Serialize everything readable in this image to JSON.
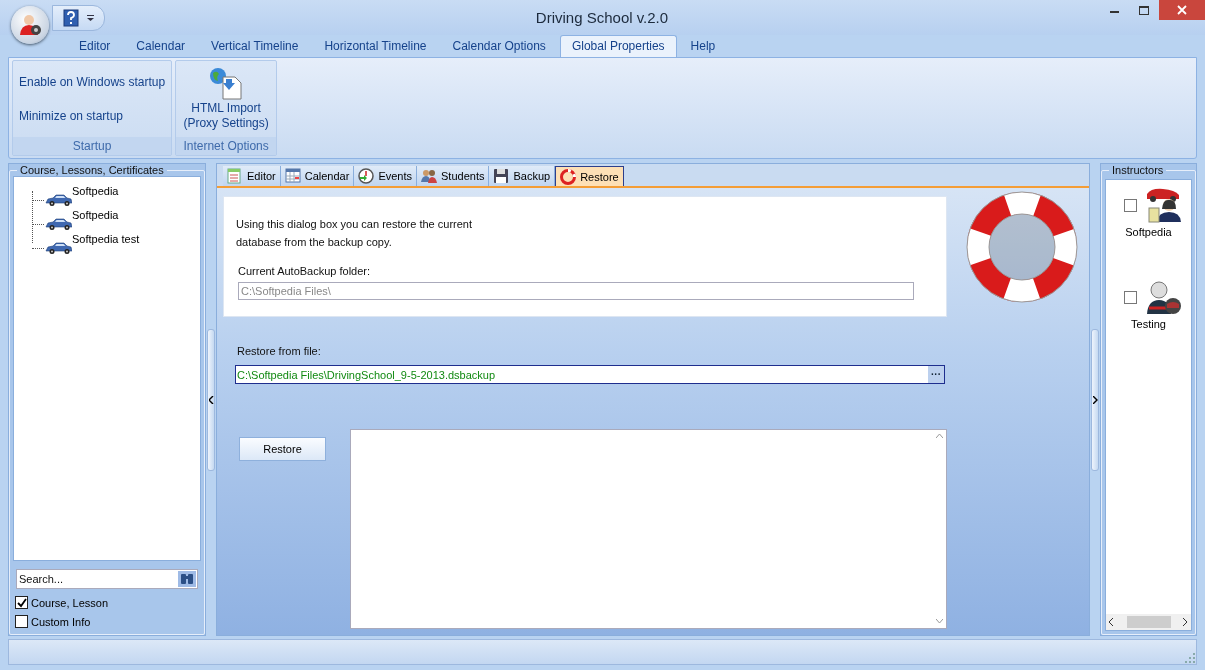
{
  "window": {
    "title": "Driving School v.2.0"
  },
  "ribbon_tabs": [
    {
      "label": "Editor",
      "selected": false
    },
    {
      "label": "Calendar",
      "selected": false
    },
    {
      "label": "Vertical Timeline",
      "selected": false
    },
    {
      "label": "Horizontal Timeline",
      "selected": false
    },
    {
      "label": "Calendar Options",
      "selected": false
    },
    {
      "label": "Global Properties",
      "selected": true
    },
    {
      "label": "Help",
      "selected": false
    }
  ],
  "ribbon_groups": [
    {
      "label": "Startup",
      "kind": "links",
      "items": [
        "Enable on Windows startup",
        "Minimize on startup"
      ]
    },
    {
      "label": "Internet Options",
      "kind": "large",
      "items": [
        "HTML Import (Proxy Settings)"
      ]
    }
  ],
  "left_panel": {
    "title": "Course, Lessons, Certificates",
    "tree": [
      {
        "label": "Softpedia"
      },
      {
        "label": "Softpedia"
      },
      {
        "label": "Softpedia test"
      }
    ],
    "search": {
      "placeholder": "Search..."
    },
    "filters": [
      {
        "label": "Course, Lesson",
        "checked": true
      },
      {
        "label": "Custom Info",
        "checked": false
      }
    ]
  },
  "content_tabs": [
    {
      "label": "Editor",
      "kind": "editor",
      "selected": false
    },
    {
      "label": "Calendar",
      "kind": "calendar",
      "selected": false
    },
    {
      "label": "Events",
      "kind": "events",
      "selected": false
    },
    {
      "label": "Students",
      "kind": "students",
      "selected": false
    },
    {
      "label": "Backup",
      "kind": "backup",
      "selected": false
    },
    {
      "label": "Restore",
      "kind": "restore",
      "selected": true
    }
  ],
  "restore": {
    "intro": "Using this dialog box you can restore the current database from the backup copy.",
    "autobackup_label": "Current AutoBackup folder:",
    "autobackup_value": "C:\\Softpedia Files\\",
    "file_label": "Restore from file:",
    "file_value": "C:\\Softpedia Files\\DrivingSchool_9-5-2013.dsbackup",
    "browse": "···",
    "button": "Restore"
  },
  "instructors": {
    "title": "Instructors",
    "items": [
      {
        "name": "Softpedia",
        "kind": "driver",
        "checked": false
      },
      {
        "name": "Testing",
        "kind": "racer",
        "checked": false
      }
    ]
  }
}
